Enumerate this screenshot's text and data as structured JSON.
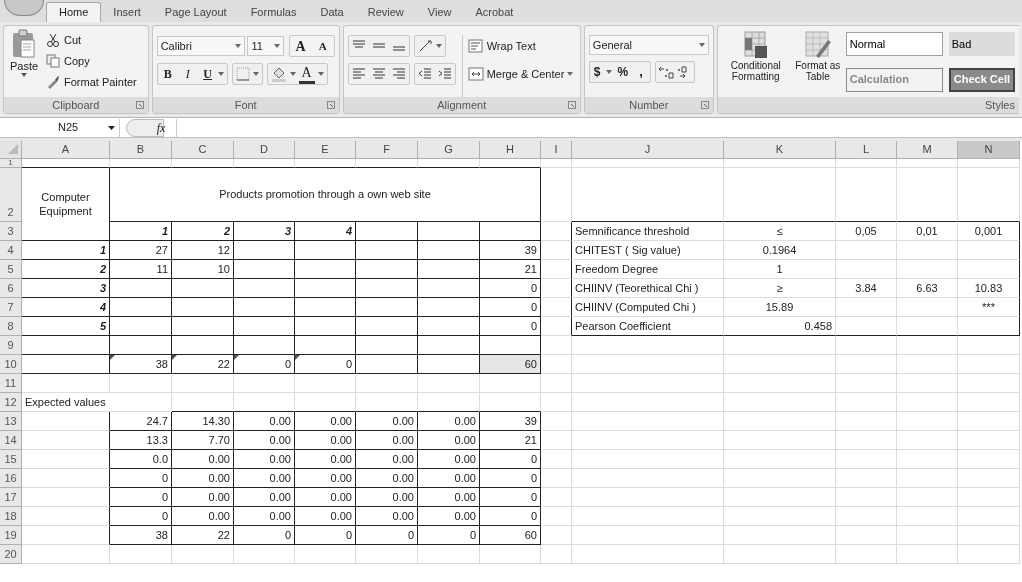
{
  "app_tabs": [
    {
      "label": "Home",
      "selected": true
    },
    {
      "label": "Insert",
      "selected": false
    },
    {
      "label": "Page Layout",
      "selected": false
    },
    {
      "label": "Formulas",
      "selected": false
    },
    {
      "label": "Data",
      "selected": false
    },
    {
      "label": "Review",
      "selected": false
    },
    {
      "label": "View",
      "selected": false
    },
    {
      "label": "Acrobat",
      "selected": false
    }
  ],
  "ribbon": {
    "clipboard": {
      "paste": "Paste",
      "cut": "Cut",
      "copy": "Copy",
      "format_painter": "Format Painter",
      "label": "Clipboard"
    },
    "font": {
      "name": "Calibri",
      "size": "11",
      "grow": "A",
      "shrink": "A",
      "bold": "B",
      "italic": "I",
      "underline": "U",
      "font_color": "A",
      "label": "Font"
    },
    "alignment": {
      "wrap_text": "Wrap Text",
      "merge": "Merge & Center",
      "label": "Alignment"
    },
    "number": {
      "format": "General",
      "currency": "$",
      "percent": "%",
      "comma": ",",
      "label": "Number"
    },
    "styles": {
      "conditional": "Conditional Formatting",
      "format_table": "Format as Table",
      "gallery": [
        {
          "label": "Normal",
          "kind": "normal"
        },
        {
          "label": "Bad",
          "kind": "bad"
        },
        {
          "label": "Calculation",
          "kind": "calculation"
        },
        {
          "label": "Check Cell",
          "kind": "check"
        }
      ],
      "label": "Styles"
    }
  },
  "formula_bar": {
    "name_box": "N25",
    "fx": "fx"
  },
  "columns": [
    {
      "label": "A",
      "selected": false
    },
    {
      "label": "B",
      "selected": false
    },
    {
      "label": "C",
      "selected": false
    },
    {
      "label": "D",
      "selected": false
    },
    {
      "label": "E",
      "selected": false
    },
    {
      "label": "F",
      "selected": false
    },
    {
      "label": "G",
      "selected": false
    },
    {
      "label": "H",
      "selected": false
    },
    {
      "label": "I",
      "selected": false
    },
    {
      "label": "J",
      "selected": false
    },
    {
      "label": "K",
      "selected": false
    },
    {
      "label": "L",
      "selected": false
    },
    {
      "label": "M",
      "selected": false
    },
    {
      "label": "N",
      "selected": true
    }
  ],
  "rows": [
    {
      "number": "1"
    },
    {
      "number": "2",
      "cells": {
        "A": {
          "text": "Computer Equipment",
          "centered": true,
          "rowspan": 2
        },
        "B": {
          "text": "Products promotion through a own web site",
          "centered": true,
          "colspan": 7
        }
      }
    },
    {
      "number": "3",
      "cells": {
        "B": {
          "text": "1",
          "emphasis": true
        },
        "C": {
          "text": "2",
          "emphasis": true
        },
        "D": {
          "text": "3",
          "emphasis": true
        },
        "E": {
          "text": "4",
          "emphasis": true
        },
        "J": {
          "text": "Semnificance threshold",
          "left_aligned": true
        },
        "K": {
          "text": "≤",
          "centered": true
        },
        "L": {
          "text": "0,05",
          "centered": true
        },
        "M": {
          "text": "0,01",
          "centered": true
        },
        "N": {
          "text": "0,001",
          "centered": true
        }
      }
    },
    {
      "number": "4",
      "cells": {
        "A": {
          "text": "1",
          "emphasis": true
        },
        "B": {
          "text": "27"
        },
        "C": {
          "text": "12"
        },
        "H": {
          "text": "39"
        },
        "J": {
          "text": "CHITEST ( Sig value)",
          "left_aligned": true
        },
        "K": {
          "text": "0.1964",
          "centered": true
        }
      }
    },
    {
      "number": "5",
      "cells": {
        "A": {
          "text": "2",
          "emphasis": true
        },
        "B": {
          "text": "11"
        },
        "C": {
          "text": "10"
        },
        "H": {
          "text": "21"
        },
        "J": {
          "text": "Freedom Degree",
          "left_aligned": true
        },
        "K": {
          "text": "1",
          "centered": true
        }
      }
    },
    {
      "number": "6",
      "cells": {
        "A": {
          "text": "3",
          "emphasis": true
        },
        "H": {
          "text": "0"
        },
        "J": {
          "text": "CHIINV (Teorethical Chi )",
          "left_aligned": true
        },
        "K": {
          "text": "≥",
          "centered": true
        },
        "L": {
          "text": "3.84",
          "centered": true
        },
        "M": {
          "text": "6.63",
          "centered": true
        },
        "N": {
          "text": "10.83",
          "centered": true
        }
      }
    },
    {
      "number": "7",
      "cells": {
        "A": {
          "text": "4",
          "emphasis": true
        },
        "H": {
          "text": "0"
        },
        "J": {
          "text": "CHIINV (Computed Chi )",
          "left_aligned": true
        },
        "K": {
          "text": "15.89",
          "centered": true
        },
        "N": {
          "text": "***",
          "centered": true
        }
      }
    },
    {
      "number": "8",
      "cells": {
        "A": {
          "text": "5",
          "emphasis": true
        },
        "H": {
          "text": "0"
        },
        "J": {
          "text": "Pearson Coefficient",
          "left_aligned": true
        },
        "K": {
          "text": "0.458"
        }
      }
    },
    {
      "number": "9"
    },
    {
      "number": "10",
      "cells": {
        "B": {
          "text": "38",
          "error_flag": true
        },
        "C": {
          "text": "22",
          "error_flag": true
        },
        "D": {
          "text": "0",
          "error_flag": true
        },
        "E": {
          "text": "0",
          "error_flag": true
        },
        "H": {
          "text": "60",
          "shaded": true
        }
      }
    },
    {
      "number": "11"
    },
    {
      "number": "12",
      "cells": {
        "A": {
          "text": "Expected values",
          "left_aligned": true,
          "colspan": 2
        }
      }
    },
    {
      "number": "13",
      "cells": {
        "B": {
          "text": "24.7"
        },
        "C": {
          "text": "14.30"
        },
        "D": {
          "text": "0.00"
        },
        "E": {
          "text": "0.00"
        },
        "F": {
          "text": "0.00"
        },
        "G": {
          "text": "0.00"
        },
        "H": {
          "text": "39"
        }
      }
    },
    {
      "number": "14",
      "cells": {
        "B": {
          "text": "13.3"
        },
        "C": {
          "text": "7.70"
        },
        "D": {
          "text": "0.00"
        },
        "E": {
          "text": "0.00"
        },
        "F": {
          "text": "0.00"
        },
        "G": {
          "text": "0.00"
        },
        "H": {
          "text": "21"
        }
      }
    },
    {
      "number": "15",
      "cells": {
        "B": {
          "text": "0.0"
        },
        "C": {
          "text": "0.00"
        },
        "D": {
          "text": "0.00"
        },
        "E": {
          "text": "0.00"
        },
        "F": {
          "text": "0.00"
        },
        "G": {
          "text": "0.00"
        },
        "H": {
          "text": "0"
        }
      }
    },
    {
      "number": "16",
      "cells": {
        "B": {
          "text": "0"
        },
        "C": {
          "text": "0.00"
        },
        "D": {
          "text": "0.00"
        },
        "E": {
          "text": "0.00"
        },
        "F": {
          "text": "0.00"
        },
        "G": {
          "text": "0.00"
        },
        "H": {
          "text": "0"
        }
      }
    },
    {
      "number": "17",
      "cells": {
        "B": {
          "text": "0"
        },
        "C": {
          "text": "0.00"
        },
        "D": {
          "text": "0.00"
        },
        "E": {
          "text": "0.00"
        },
        "F": {
          "text": "0.00"
        },
        "G": {
          "text": "0.00"
        },
        "H": {
          "text": "0"
        }
      }
    },
    {
      "number": "18",
      "cells": {
        "B": {
          "text": "0"
        },
        "C": {
          "text": "0.00"
        },
        "D": {
          "text": "0.00"
        },
        "E": {
          "text": "0.00"
        },
        "F": {
          "text": "0.00"
        },
        "G": {
          "text": "0.00"
        },
        "H": {
          "text": "0"
        }
      }
    },
    {
      "number": "19",
      "cells": {
        "B": {
          "text": "38"
        },
        "C": {
          "text": "22"
        },
        "D": {
          "text": "0"
        },
        "E": {
          "text": "0"
        },
        "F": {
          "text": "0"
        },
        "G": {
          "text": "0"
        },
        "H": {
          "text": "60"
        }
      }
    },
    {
      "number": "20"
    }
  ]
}
